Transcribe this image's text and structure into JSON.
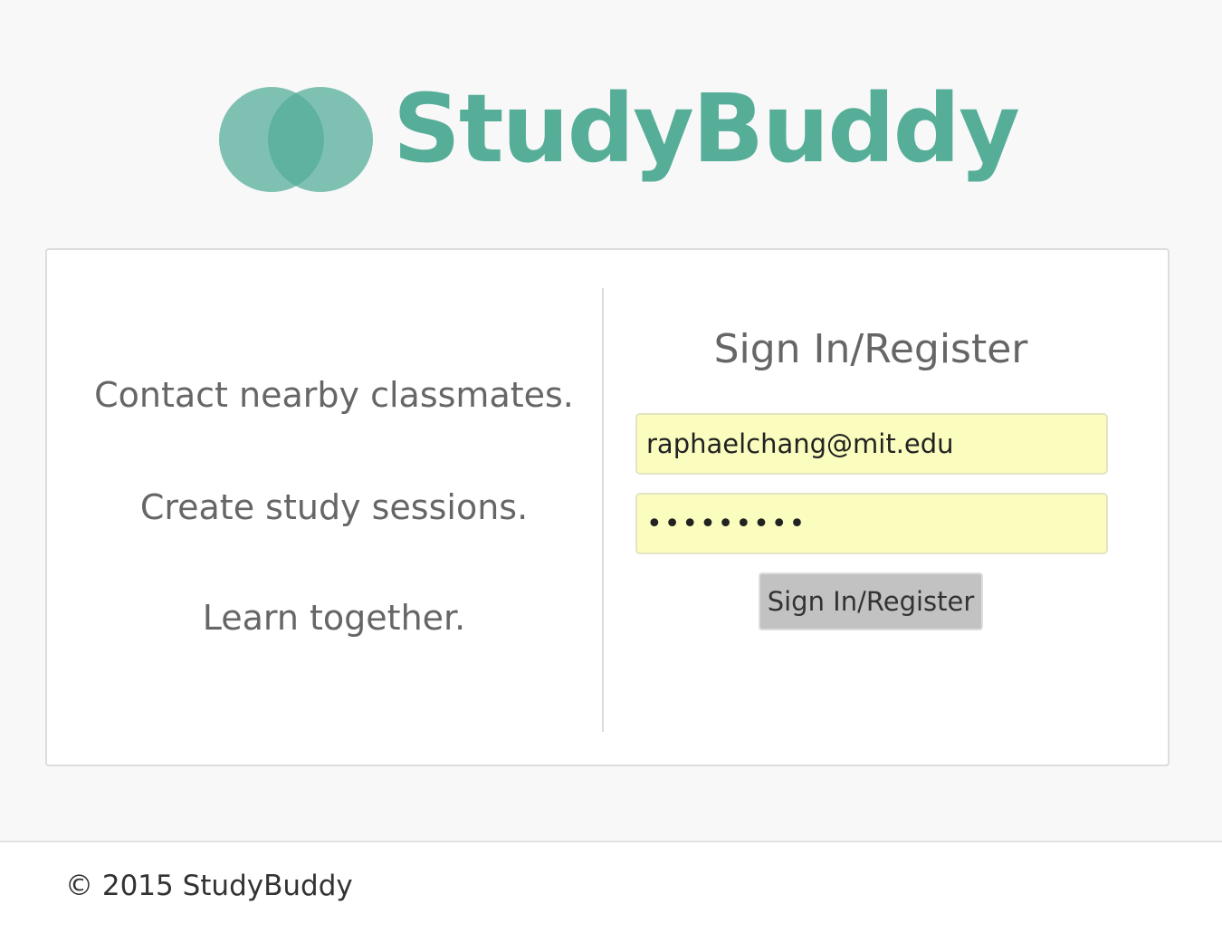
{
  "brand": {
    "name": "StudyBuddy",
    "color": "#56ae99",
    "logo_icon": "overlapping-circles-icon"
  },
  "taglines": [
    "Contact nearby classmates.",
    "Create study sessions.",
    "Learn together."
  ],
  "signin": {
    "title": "Sign In/Register",
    "email_value": "raphaelchang@mit.edu",
    "password_value": "123456789",
    "button_label": "Sign In/Register",
    "field_bg_color": "#fafdbd"
  },
  "footer": {
    "text": "© 2015 StudyBuddy"
  }
}
